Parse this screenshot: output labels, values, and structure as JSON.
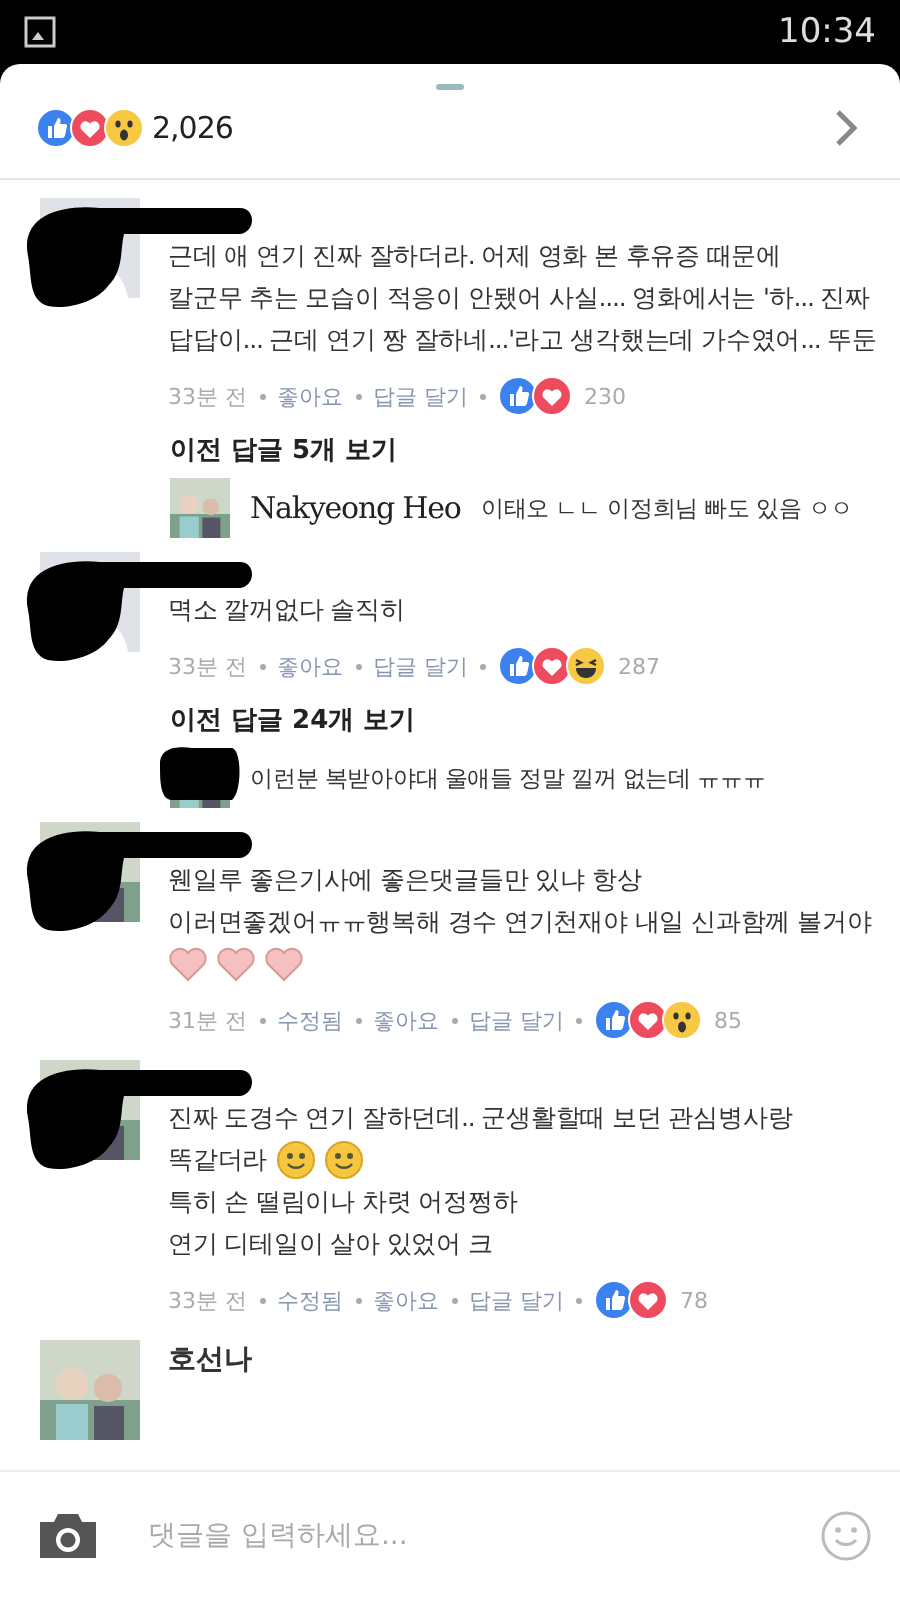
{
  "status_bar": {
    "time": "10:34"
  },
  "summary": {
    "reactions": [
      {
        "kind": "like"
      },
      {
        "kind": "love"
      },
      {
        "kind": "wow"
      }
    ],
    "count": "2,026"
  },
  "thread": [
    {
      "kind": "comment",
      "avatar": {
        "kind": "default"
      },
      "redacted": true,
      "lines": [
        {
          "text": "근데 애 연기 진짜 잘하더라. 어제 영화 본 후유증 때문에"
        },
        {
          "text": "칼군무 추는 모습이 적응이 안됐어 사실.... 영화에서는 '하... 진짜"
        },
        {
          "text": "답답이... 근데 연기 짱 잘하네...'라고 생각했는데 가수였어... 뚜둔"
        }
      ],
      "meta": [
        "33분 전",
        "좋아요",
        "답글 달기"
      ],
      "reactions": [
        {
          "kind": "like"
        },
        {
          "kind": "love"
        }
      ],
      "count": "230"
    },
    {
      "kind": "more",
      "text": "이전 답글 5개 보기"
    },
    {
      "kind": "reply",
      "avatar": {
        "kind": "picture"
      },
      "author": "Nakyeong Heo",
      "text": "이태오 ㄴㄴ 이정희님 빠도 있음 ㅇㅇ"
    },
    {
      "kind": "comment",
      "avatar": {
        "kind": "default"
      },
      "redacted": true,
      "lines": [
        {
          "text": "멱소 깔꺼없다 솔직히"
        }
      ],
      "meta": [
        "33분 전",
        "좋아요",
        "답글 달기"
      ],
      "reactions": [
        {
          "kind": "like"
        },
        {
          "kind": "love"
        },
        {
          "kind": "haha"
        }
      ],
      "count": "287"
    },
    {
      "kind": "more",
      "text": "이전 답글 24개 보기"
    },
    {
      "kind": "reply",
      "avatar": {
        "kind": "picture"
      },
      "redacted": true,
      "text": "이런분 복받아야대 울애들 정말 낄꺼 없는데 ㅠㅠㅠ"
    },
    {
      "kind": "comment",
      "avatar": {
        "kind": "picture"
      },
      "redacted": true,
      "lines": [
        {
          "text": "웬일루 좋은기사에 좋은댓글들만 있냐 항상"
        },
        {
          "text": "이러면좋겠어ㅠㅠ행복해 경수 연기천재야 내일 신과함께 볼거야"
        },
        {
          "emojis": [
            {
              "kind": "heart"
            },
            {
              "kind": "heart"
            },
            {
              "kind": "heart"
            }
          ]
        }
      ],
      "meta": [
        "31분 전",
        "수정됨",
        "좋아요",
        "답글 달기"
      ],
      "reactions": [
        {
          "kind": "like"
        },
        {
          "kind": "love"
        },
        {
          "kind": "wow"
        }
      ],
      "count": "85"
    },
    {
      "kind": "comment",
      "avatar": {
        "kind": "picture"
      },
      "redacted": true,
      "lines": [
        {
          "text": "진짜 도경수 연기 잘하던데.. 군생활할때 보던 관심병사랑"
        },
        {
          "text": "똑같더라",
          "emojis": [
            {
              "kind": "smile"
            },
            {
              "kind": "smile"
            }
          ]
        },
        {
          "text": "특히 손 떨림이나 차렷 어정쩡하"
        },
        {
          "text": "연기 디테일이 살아 있었어 크"
        }
      ],
      "meta": [
        "33분 전",
        "수정됨",
        "좋아요",
        "답글 달기"
      ],
      "reactions": [
        {
          "kind": "like"
        },
        {
          "kind": "love"
        }
      ],
      "count": "78"
    },
    {
      "kind": "author",
      "avatar": {
        "kind": "picture"
      },
      "author": "호선나"
    }
  ],
  "composer": {
    "placeholder": "댓글을 입력하세요..."
  }
}
